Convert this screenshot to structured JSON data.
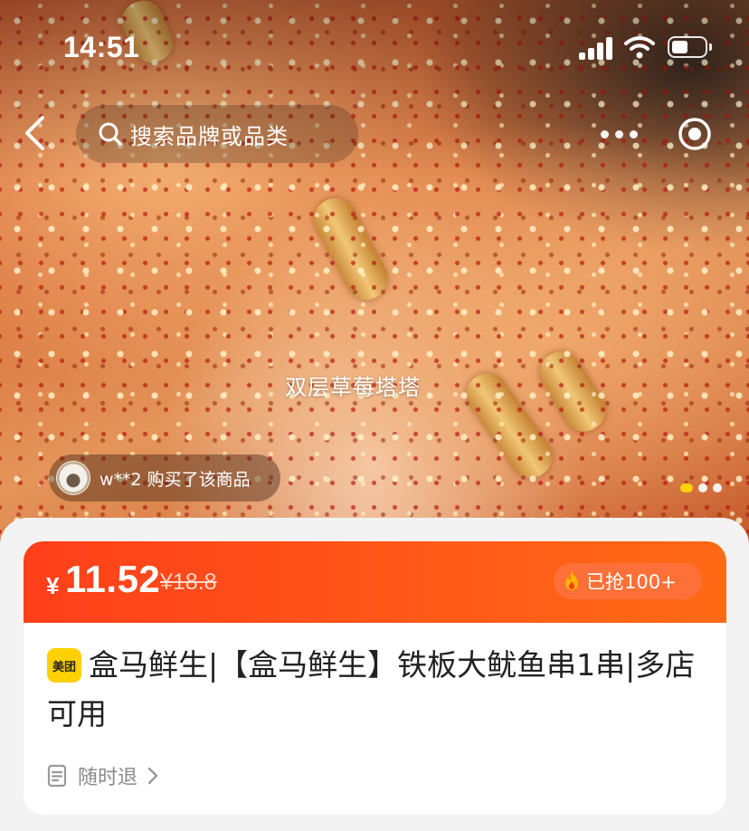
{
  "status_bar": {
    "time": "14:51"
  },
  "nav": {
    "search_placeholder": "搜索品牌或品类"
  },
  "hero": {
    "overlay_caption": "双层草莓塔塔",
    "buyer_notice": "w**2 购买了该商品",
    "pager": {
      "total": 3,
      "active_index": 0
    }
  },
  "price_bar": {
    "currency_symbol": "¥",
    "price": "11.52",
    "original_price": "¥18.8",
    "sold_label": "已抢100+"
  },
  "product": {
    "brand_badge": "美团",
    "title": "盒马鲜生|【盒马鲜生】铁板大鱿鱼串1串|多店可用",
    "refund_policy": "随时退"
  },
  "colors": {
    "price_bar": "#ff4a1a",
    "brand_yellow": "#ffd100",
    "pager_active": "#ffd100"
  },
  "icons": {
    "back": "chevron-left-icon",
    "search": "search-icon",
    "more": "more-dots-icon",
    "target": "target-icon",
    "fire": "fire-icon",
    "doc": "doc-icon",
    "chevron": "chevron-right-icon"
  }
}
